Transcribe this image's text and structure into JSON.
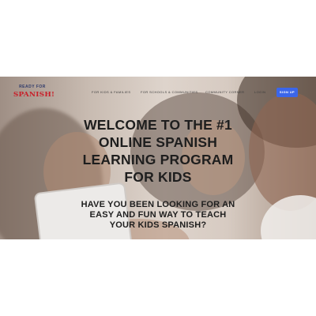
{
  "brand": {
    "tagline": "READY FOR",
    "name": "SPANISH!"
  },
  "nav": {
    "items": [
      {
        "label": "FOR KIDS & FAMILIES"
      },
      {
        "label": "FOR SCHOOLS & COMMUNITIES"
      },
      {
        "label": "COMMUNITY CORNER"
      },
      {
        "label": "LOGIN"
      }
    ],
    "signup_label": "SIGN UP"
  },
  "hero": {
    "headline": "WELCOME TO THE #1 ONLINE SPANISH LEARNING PROGRAM FOR KIDS",
    "subheadline": "HAVE YOU BEEN LOOKING FOR AN EASY AND FUN WAY TO TEACH YOUR KIDS SPANISH?"
  },
  "colors": {
    "accent": "#3b66ea",
    "brand_red": "#c8202a",
    "brand_navy": "#2f3b6b"
  }
}
